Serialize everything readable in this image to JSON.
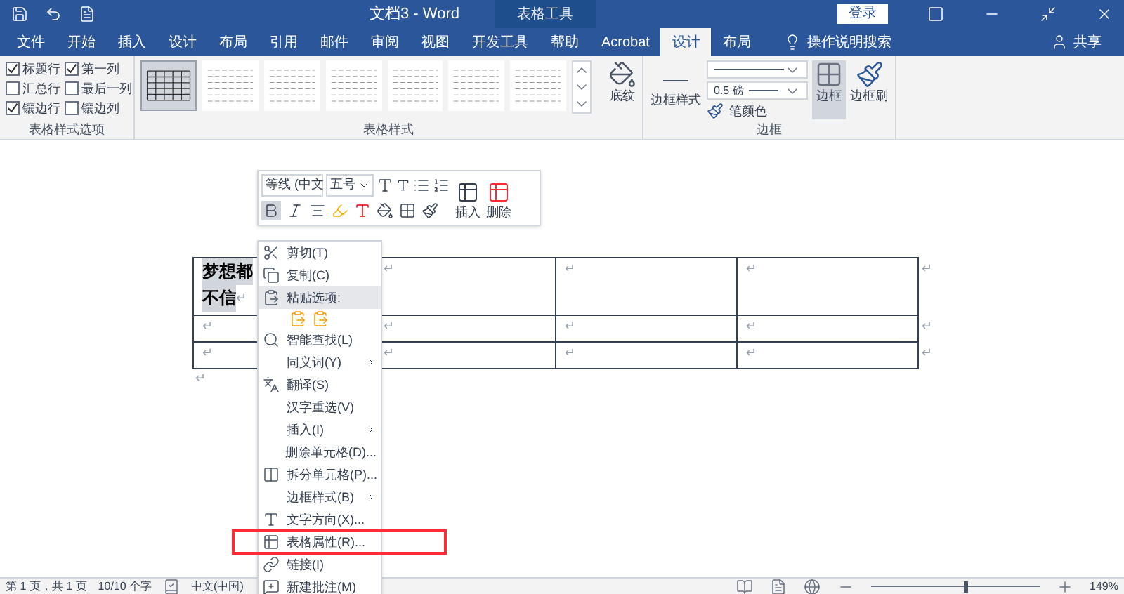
{
  "window": {
    "title": "文档3  -  Word",
    "context_tab": "表格工具",
    "login": "登录"
  },
  "tabs": [
    {
      "label": "文件",
      "selected": false
    },
    {
      "label": "开始",
      "selected": false
    },
    {
      "label": "插入",
      "selected": false
    },
    {
      "label": "设计",
      "selected": false
    },
    {
      "label": "布局",
      "selected": false
    },
    {
      "label": "引用",
      "selected": false
    },
    {
      "label": "邮件",
      "selected": false
    },
    {
      "label": "审阅",
      "selected": false
    },
    {
      "label": "视图",
      "selected": false
    },
    {
      "label": "开发工具",
      "selected": false
    },
    {
      "label": "帮助",
      "selected": false
    },
    {
      "label": "Acrobat",
      "selected": false
    },
    {
      "label": "设计",
      "selected": true
    },
    {
      "label": "布局",
      "selected": false
    }
  ],
  "tell_me": "操作说明搜索",
  "share": "共享",
  "ribbon": {
    "style_options": {
      "label": "表格样式选项",
      "options": [
        {
          "label": "标题行",
          "checked": true
        },
        {
          "label": "第一列",
          "checked": true
        },
        {
          "label": "汇总行",
          "checked": false
        },
        {
          "label": "最后一列",
          "checked": false
        },
        {
          "label": "镶边行",
          "checked": true
        },
        {
          "label": "镶边列",
          "checked": false
        }
      ]
    },
    "table_styles": {
      "label": "表格样式",
      "styles": [
        {
          "selected": true
        },
        {
          "selected": false
        },
        {
          "selected": false
        },
        {
          "selected": false
        },
        {
          "selected": false
        },
        {
          "selected": false
        },
        {
          "selected": false
        }
      ],
      "shading": "底纹"
    },
    "borders": {
      "label": "边框",
      "border_styles": "边框样式",
      "weight": "0.5 磅",
      "pen_color": "笔颜色",
      "borders_button": {
        "label": "边框",
        "selected": true
      },
      "border_painter": "边框刷"
    }
  },
  "mini_toolbar": {
    "font": "等线 (中文",
    "size": "五号",
    "insert": "插入",
    "delete": "删除",
    "bold": {
      "selected": true
    }
  },
  "table": {
    "rows": [
      {
        "cells": [
          {
            "lines": [
              "梦想都",
              "不信"
            ],
            "mark": "↵"
          },
          {
            "mark": "↵"
          },
          {
            "mark": "↵"
          },
          {
            "mark": "↵"
          }
        ],
        "end_mark": "↵"
      },
      {
        "cells": [
          {
            "mark": "↵"
          },
          {
            "mark": "↵"
          },
          {
            "mark": "↵"
          },
          {
            "mark": "↵"
          }
        ],
        "end_mark": "↵"
      },
      {
        "cells": [
          {
            "mark": "↵"
          },
          {
            "mark": "↵"
          },
          {
            "mark": "↵"
          },
          {
            "mark": "↵"
          }
        ],
        "end_mark": "↵"
      }
    ],
    "after_table": "↵"
  },
  "context_menu": [
    {
      "kind": "item",
      "label": "剪切(T)",
      "selected": false,
      "submenu": false
    },
    {
      "kind": "item",
      "label": "复制(C)",
      "selected": false,
      "submenu": false
    },
    {
      "kind": "item",
      "label": "粘贴选项:",
      "selected": true,
      "submenu": false
    },
    {
      "kind": "paste"
    },
    {
      "kind": "item",
      "label": "智能查找(L)",
      "selected": false,
      "submenu": false
    },
    {
      "kind": "item",
      "label": "同义词(Y)",
      "selected": false,
      "submenu": true
    },
    {
      "kind": "item",
      "label": "翻译(S)",
      "selected": false,
      "submenu": false
    },
    {
      "kind": "item",
      "label": "汉字重选(V)",
      "selected": false,
      "submenu": false
    },
    {
      "kind": "item",
      "label": "插入(I)",
      "selected": false,
      "submenu": true
    },
    {
      "kind": "item",
      "label": "删除单元格(D)...",
      "selected": false,
      "submenu": false
    },
    {
      "kind": "item",
      "label": "拆分单元格(P)...",
      "selected": false,
      "submenu": false
    },
    {
      "kind": "item",
      "label": "边框样式(B)",
      "selected": false,
      "submenu": true
    },
    {
      "kind": "item",
      "label": "文字方向(X)...",
      "selected": false,
      "submenu": false
    },
    {
      "kind": "item",
      "label": "表格属性(R)...",
      "selected": false,
      "submenu": false
    },
    {
      "kind": "item",
      "label": "链接(I)",
      "selected": false,
      "submenu": false
    },
    {
      "kind": "item",
      "label": "新建批注(M)",
      "selected": false,
      "submenu": false
    }
  ],
  "status_bar": {
    "page": "第 1 页，共 1 页",
    "words": "10/10 个字",
    "language": "中文(中国)",
    "zoom": {
      "level": 0.55,
      "reading": "149%"
    }
  }
}
